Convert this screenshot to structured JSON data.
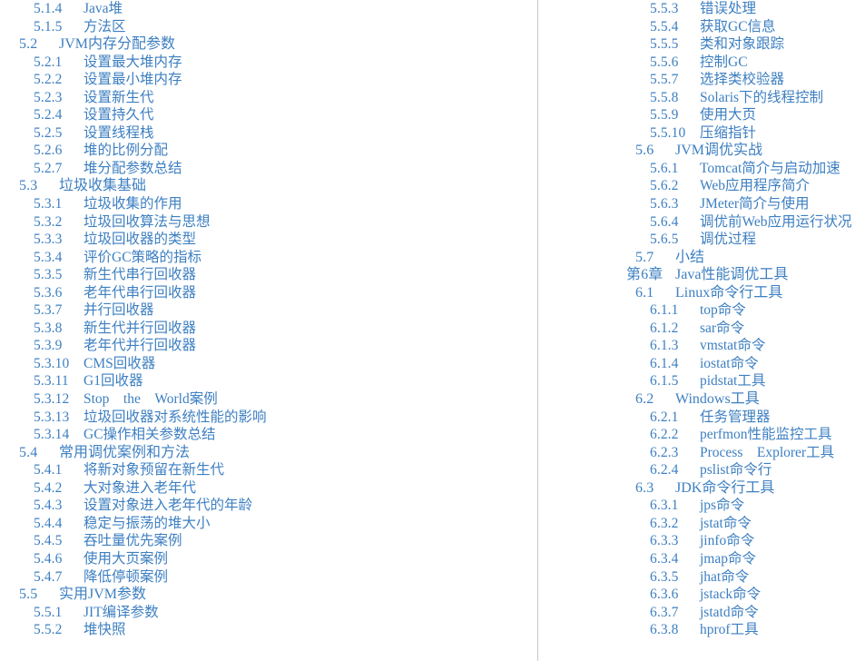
{
  "document": {
    "kind": "table-of-contents",
    "text_color": "#3d7fc1",
    "divider_color": "#c8c9cd",
    "background_color": "#ffffff"
  },
  "columns": {
    "left": {
      "entries": [
        {
          "level": 3,
          "num": "5.1.4",
          "title": "Java堆"
        },
        {
          "level": 3,
          "num": "5.1.5",
          "title": "方法区"
        },
        {
          "level": 2,
          "num": "5.2",
          "title": "JVM内存分配参数"
        },
        {
          "level": 3,
          "num": "5.2.1",
          "title": "设置最大堆内存"
        },
        {
          "level": 3,
          "num": "5.2.2",
          "title": "设置最小堆内存"
        },
        {
          "level": 3,
          "num": "5.2.3",
          "title": "设置新生代"
        },
        {
          "level": 3,
          "num": "5.2.4",
          "title": "设置持久代"
        },
        {
          "level": 3,
          "num": "5.2.5",
          "title": "设置线程栈"
        },
        {
          "level": 3,
          "num": "5.2.6",
          "title": "堆的比例分配"
        },
        {
          "level": 3,
          "num": "5.2.7",
          "title": "堆分配参数总结"
        },
        {
          "level": 2,
          "num": "5.3",
          "title": "垃圾收集基础"
        },
        {
          "level": 3,
          "num": "5.3.1",
          "title": "垃圾收集的作用"
        },
        {
          "level": 3,
          "num": "5.3.2",
          "title": "垃圾回收算法与思想"
        },
        {
          "level": 3,
          "num": "5.3.3",
          "title": "垃圾回收器的类型"
        },
        {
          "level": 3,
          "num": "5.3.4",
          "title": "评价GC策略的指标"
        },
        {
          "level": 3,
          "num": "5.3.5",
          "title": "新生代串行回收器"
        },
        {
          "level": 3,
          "num": "5.3.6",
          "title": "老年代串行回收器"
        },
        {
          "level": 3,
          "num": "5.3.7",
          "title": "并行回收器"
        },
        {
          "level": 3,
          "num": "5.3.8",
          "title": "新生代并行回收器"
        },
        {
          "level": 3,
          "num": "5.3.9",
          "title": "老年代并行回收器"
        },
        {
          "level": 3,
          "num": "5.3.10",
          "title": "CMS回收器"
        },
        {
          "level": 3,
          "num": "5.3.11",
          "title": "G1回收器"
        },
        {
          "level": 3,
          "num": "5.3.12",
          "title": "Stop　the　World案例"
        },
        {
          "level": 3,
          "num": "5.3.13",
          "title": "垃圾回收器对系统性能的影响"
        },
        {
          "level": 3,
          "num": "5.3.14",
          "title": "GC操作相关参数总结"
        },
        {
          "level": 2,
          "num": "5.4",
          "title": "常用调优案例和方法"
        },
        {
          "level": 3,
          "num": "5.4.1",
          "title": "将新对象预留在新生代"
        },
        {
          "level": 3,
          "num": "5.4.2",
          "title": "大对象进入老年代"
        },
        {
          "level": 3,
          "num": "5.4.3",
          "title": "设置对象进入老年代的年龄"
        },
        {
          "level": 3,
          "num": "5.4.4",
          "title": "稳定与振荡的堆大小"
        },
        {
          "level": 3,
          "num": "5.4.5",
          "title": "吞吐量优先案例"
        },
        {
          "level": 3,
          "num": "5.4.6",
          "title": "使用大页案例"
        },
        {
          "level": 3,
          "num": "5.4.7",
          "title": "降低停顿案例"
        },
        {
          "level": 2,
          "num": "5.5",
          "title": "实用JVM参数"
        },
        {
          "level": 3,
          "num": "5.5.1",
          "title": "JIT编译参数"
        },
        {
          "level": 3,
          "num": "5.5.2",
          "title": "堆快照"
        }
      ]
    },
    "right": {
      "entries": [
        {
          "level": 3,
          "num": "5.5.3",
          "title": "错误处理"
        },
        {
          "level": 3,
          "num": "5.5.4",
          "title": "获取GC信息"
        },
        {
          "level": 3,
          "num": "5.5.5",
          "title": "类和对象跟踪"
        },
        {
          "level": 3,
          "num": "5.5.6",
          "title": "控制GC"
        },
        {
          "level": 3,
          "num": "5.5.7",
          "title": "选择类校验器"
        },
        {
          "level": 3,
          "num": "5.5.8",
          "title": "Solaris下的线程控制"
        },
        {
          "level": 3,
          "num": "5.5.9",
          "title": "使用大页"
        },
        {
          "level": 3,
          "num": "5.5.10",
          "title": "压缩指针"
        },
        {
          "level": 2,
          "num": "5.6",
          "title": "JVM调优实战"
        },
        {
          "level": 3,
          "num": "5.6.1",
          "title": "Tomcat简介与启动加速"
        },
        {
          "level": 3,
          "num": "5.6.2",
          "title": "Web应用程序简介"
        },
        {
          "level": 3,
          "num": "5.6.3",
          "title": "JMeter简介与使用"
        },
        {
          "level": 3,
          "num": "5.6.4",
          "title": "调优前Web应用运行状况"
        },
        {
          "level": 3,
          "num": "5.6.5",
          "title": "调优过程"
        },
        {
          "level": 2,
          "num": "5.7",
          "title": "小结"
        },
        {
          "level": 1,
          "num": "第6章",
          "title": "Java性能调优工具"
        },
        {
          "level": 2,
          "num": "6.1",
          "title": "Linux命令行工具"
        },
        {
          "level": 3,
          "num": "6.1.1",
          "title": "top命令"
        },
        {
          "level": 3,
          "num": "6.1.2",
          "title": "sar命令"
        },
        {
          "level": 3,
          "num": "6.1.3",
          "title": "vmstat命令"
        },
        {
          "level": 3,
          "num": "6.1.4",
          "title": "iostat命令"
        },
        {
          "level": 3,
          "num": "6.1.5",
          "title": "pidstat工具"
        },
        {
          "level": 2,
          "num": "6.2",
          "title": "Windows工具"
        },
        {
          "level": 3,
          "num": "6.2.1",
          "title": "任务管理器"
        },
        {
          "level": 3,
          "num": "6.2.2",
          "title": "perfmon性能监控工具"
        },
        {
          "level": 3,
          "num": "6.2.3",
          "title": "Process　Explorer工具"
        },
        {
          "level": 3,
          "num": "6.2.4",
          "title": "pslist命令行"
        },
        {
          "level": 2,
          "num": "6.3",
          "title": "JDK命令行工具"
        },
        {
          "level": 3,
          "num": "6.3.1",
          "title": "jps命令"
        },
        {
          "level": 3,
          "num": "6.3.2",
          "title": "jstat命令"
        },
        {
          "level": 3,
          "num": "6.3.3",
          "title": "jinfo命令"
        },
        {
          "level": 3,
          "num": "6.3.4",
          "title": "jmap命令"
        },
        {
          "level": 3,
          "num": "6.3.5",
          "title": "jhat命令"
        },
        {
          "level": 3,
          "num": "6.3.6",
          "title": "jstack命令"
        },
        {
          "level": 3,
          "num": "6.3.7",
          "title": "jstatd命令"
        },
        {
          "level": 3,
          "num": "6.3.8",
          "title": "hprof工具"
        }
      ]
    }
  }
}
